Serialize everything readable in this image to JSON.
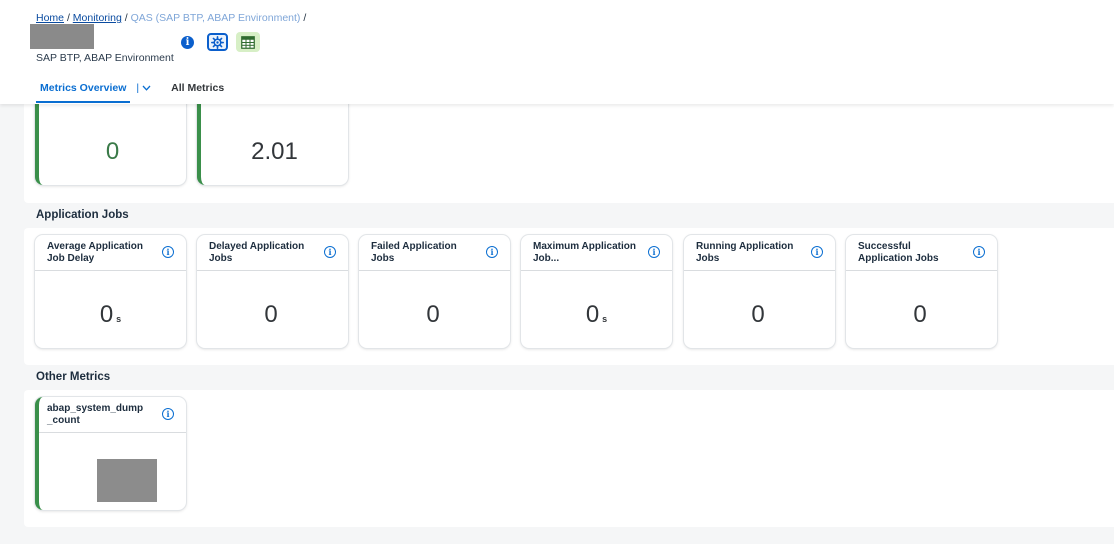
{
  "breadcrumb": {
    "home": "Home",
    "monitoring": "Monitoring",
    "system": "QAS (SAP BTP, ABAP Environment)",
    "sep": "/"
  },
  "header": {
    "subtitle": "SAP BTP, ABAP Environment",
    "icons": [
      "info-icon",
      "settings-icon",
      "spreadsheet-icon"
    ]
  },
  "tabs": {
    "overview": "Metrics Overview",
    "separator": "|",
    "chevron": "⌄",
    "all": "All Metrics"
  },
  "top_tiles": [
    {
      "value": "0"
    },
    {
      "value": "2.01"
    }
  ],
  "sections": {
    "jobs": "Application Jobs",
    "other": "Other Metrics"
  },
  "app_jobs": [
    {
      "title": "Average Application Job Delay",
      "value": "0",
      "unit": "s"
    },
    {
      "title": "Delayed Application Jobs",
      "value": "0",
      "unit": ""
    },
    {
      "title": "Failed Application Jobs",
      "value": "0",
      "unit": ""
    },
    {
      "title": "Maximum Application Job...",
      "value": "0",
      "unit": "s"
    },
    {
      "title": "Running Application Jobs",
      "value": "0",
      "unit": ""
    },
    {
      "title": "Successful Application Jobs",
      "value": "0",
      "unit": ""
    }
  ],
  "other_metrics": [
    {
      "title": "abap_system_dump _count"
    }
  ],
  "info_glyph": "i",
  "colors": {
    "accent_blue": "#0a6ed1",
    "accent_green": "#3a8f4a"
  }
}
